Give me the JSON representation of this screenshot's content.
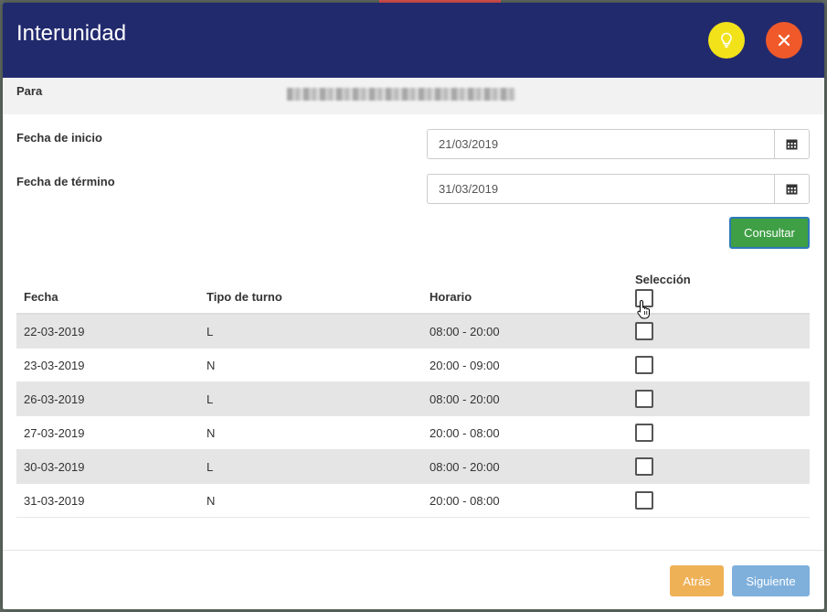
{
  "modal": {
    "title": "Interunidad",
    "hint_icon": "lightbulb-icon",
    "close_icon": "close-icon",
    "colors": {
      "header": "#222a6e",
      "hint": "#f2e21a",
      "close": "#f05a2a"
    }
  },
  "form": {
    "para_label": "Para",
    "start_label": "Fecha de inicio",
    "start_value": "21/03/2019",
    "end_label": "Fecha de término",
    "end_value": "31/03/2019",
    "calendar_icon": "calendar-icon",
    "consult_label": "Consultar"
  },
  "table": {
    "headers": {
      "fecha": "Fecha",
      "tipo": "Tipo de turno",
      "horario": "Horario",
      "seleccion": "Selección"
    },
    "rows": [
      {
        "fecha": "22-03-2019",
        "tipo": "L",
        "horario": "08:00 - 20:00",
        "checked": false
      },
      {
        "fecha": "23-03-2019",
        "tipo": "N",
        "horario": "20:00 - 09:00",
        "checked": false
      },
      {
        "fecha": "26-03-2019",
        "tipo": "L",
        "horario": "08:00 - 20:00",
        "checked": false
      },
      {
        "fecha": "27-03-2019",
        "tipo": "N",
        "horario": "20:00 - 08:00",
        "checked": false
      },
      {
        "fecha": "30-03-2019",
        "tipo": "L",
        "horario": "08:00 - 20:00",
        "checked": false
      },
      {
        "fecha": "31-03-2019",
        "tipo": "N",
        "horario": "20:00 - 08:00",
        "checked": false
      }
    ]
  },
  "footer": {
    "back_label": "Atrás",
    "next_label": "Siguiente",
    "colors": {
      "back": "#efad4d",
      "next": "#7fb0dc",
      "consult": "#3f9f45"
    }
  }
}
